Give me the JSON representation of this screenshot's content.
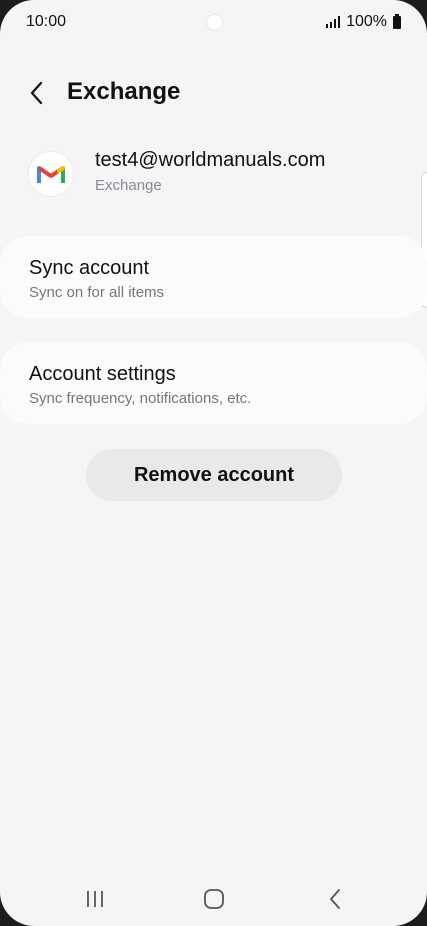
{
  "status_bar": {
    "time": "10:00",
    "battery": "100%"
  },
  "header": {
    "title": "Exchange",
    "back_icon": "chevron-left-icon"
  },
  "account": {
    "email": "test4@worldmanuals.com",
    "type": "Exchange",
    "icon": "gmail-icon"
  },
  "sync_card": {
    "title": "Sync account",
    "subtitle": "Sync on for all items"
  },
  "settings_card": {
    "title": "Account settings",
    "subtitle": "Sync frequency, notifications, etc."
  },
  "remove_button": {
    "label": "Remove account"
  },
  "navbar": {
    "recents_icon": "recents-icon",
    "home_icon": "home-icon",
    "back_icon": "back-icon"
  },
  "colors": {
    "background": "#f5f5f7",
    "card": "#fbfbfd",
    "button": "#e9e9eb"
  }
}
